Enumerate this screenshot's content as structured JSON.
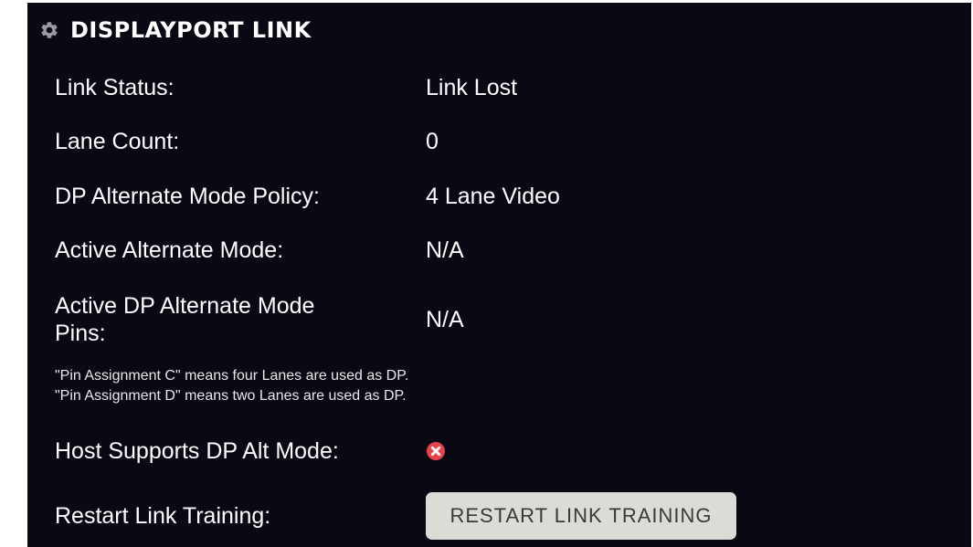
{
  "panel": {
    "title": "DISPLAYPORT LINK",
    "icon": "gear-icon"
  },
  "rows": {
    "link_status": {
      "label": "Link Status:",
      "value": "Link Lost"
    },
    "lane_count": {
      "label": "Lane Count:",
      "value": "0"
    },
    "dp_alt_mode_policy": {
      "label": "DP Alternate Mode Policy:",
      "value": "4 Lane Video"
    },
    "active_alt_mode": {
      "label": "Active Alternate Mode:",
      "value": "N/A"
    },
    "active_dp_alt_mode_pins": {
      "label": "Active DP Alternate Mode Pins:",
      "value": "N/A"
    },
    "host_supports_dp_alt_mode": {
      "label": "Host Supports DP Alt Mode:",
      "icon": "error-circle-icon",
      "icon_color": "#e8414a"
    },
    "restart_link_training": {
      "label": "Restart Link Training:",
      "button_label": "RESTART LINK TRAINING"
    }
  },
  "notes": [
    "\"Pin Assignment C\" means four Lanes are used as DP.",
    "\"Pin Assignment D\" means two Lanes are used as DP."
  ],
  "colors": {
    "panel_background": "#090914",
    "text": "#ffffff",
    "button_background": "#dcdbd6",
    "button_text": "#3a3a3a",
    "error": "#e8414a"
  }
}
